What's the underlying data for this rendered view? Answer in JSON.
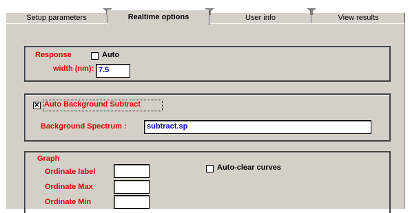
{
  "tabs": [
    {
      "label": "Setup parameters",
      "active": false
    },
    {
      "label": "Realtime options",
      "active": true
    },
    {
      "label": "User info",
      "active": false
    },
    {
      "label": "View results",
      "active": false
    }
  ],
  "response_group": {
    "response_label": "Response",
    "auto_label": "Auto",
    "auto_checked": false,
    "width_label": "width (nm):",
    "width_value": "7.5"
  },
  "background_group": {
    "auto_subtract_label": "Auto Background Subtract",
    "auto_subtract_checked": true,
    "spectrum_label": "Background Spectrum :",
    "spectrum_value": "subtract.sp"
  },
  "graph_group": {
    "title": "Graph",
    "ordinate_label_label": "Ordinate label",
    "ordinate_label_value": "",
    "ordinate_max_label": "Ordinate Max",
    "ordinate_max_value": "",
    "ordinate_min_label": "Ordinate Min",
    "ordinate_min_value": "",
    "auto_clear_label": "Auto-clear curves",
    "auto_clear_checked": false
  },
  "colors": {
    "label_red": "#e00000",
    "value_blue": "#0000c0",
    "panel_gray": "#d4d0c8"
  }
}
